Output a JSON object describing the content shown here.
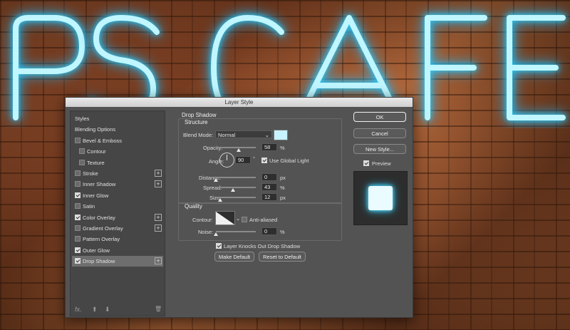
{
  "background": {
    "neon_text": "PS CAFE",
    "neon_color": "#2ad4ff"
  },
  "dialog": {
    "title": "Layer Style",
    "styles_list": [
      {
        "label": "Styles",
        "checkbox": false,
        "checked": false,
        "plus": false,
        "selected": false,
        "indent": 0
      },
      {
        "label": "Blending Options",
        "checkbox": false,
        "checked": false,
        "plus": false,
        "selected": false,
        "indent": 0
      },
      {
        "label": "Bevel & Emboss",
        "checkbox": true,
        "checked": false,
        "plus": false,
        "selected": false,
        "indent": 0
      },
      {
        "label": "Contour",
        "checkbox": true,
        "checked": false,
        "plus": false,
        "selected": false,
        "indent": 1
      },
      {
        "label": "Texture",
        "checkbox": true,
        "checked": false,
        "plus": false,
        "selected": false,
        "indent": 1
      },
      {
        "label": "Stroke",
        "checkbox": true,
        "checked": false,
        "plus": true,
        "selected": false,
        "indent": 0
      },
      {
        "label": "Inner Shadow",
        "checkbox": true,
        "checked": false,
        "plus": true,
        "selected": false,
        "indent": 0
      },
      {
        "label": "Inner Glow",
        "checkbox": true,
        "checked": true,
        "plus": false,
        "selected": false,
        "indent": 0
      },
      {
        "label": "Satin",
        "checkbox": true,
        "checked": false,
        "plus": false,
        "selected": false,
        "indent": 0
      },
      {
        "label": "Color Overlay",
        "checkbox": true,
        "checked": true,
        "plus": true,
        "selected": false,
        "indent": 0
      },
      {
        "label": "Gradient Overlay",
        "checkbox": true,
        "checked": false,
        "plus": true,
        "selected": false,
        "indent": 0
      },
      {
        "label": "Pattern Overlay",
        "checkbox": true,
        "checked": false,
        "plus": false,
        "selected": false,
        "indent": 0
      },
      {
        "label": "Outer Glow",
        "checkbox": true,
        "checked": true,
        "plus": false,
        "selected": false,
        "indent": 0
      },
      {
        "label": "Drop Shadow",
        "checkbox": true,
        "checked": true,
        "plus": true,
        "selected": true,
        "indent": 0
      }
    ],
    "footer": {
      "fx": "fx.",
      "up": "⬆",
      "down": "⬇",
      "trash": "🗑"
    },
    "drop_shadow": {
      "title": "Drop Shadow",
      "structure": {
        "label": "Structure",
        "blend_mode_label": "Blend Mode:",
        "blend_mode_value": "Normal",
        "color": "#c8f2ff",
        "opacity_label": "Opacity:",
        "opacity_value": "58",
        "opacity_unit": "%",
        "opacity_fraction": 0.58,
        "angle_label": "Angle:",
        "angle_value": "90",
        "angle_unit": "°",
        "global_light_label": "Use Global Light",
        "global_light_checked": true,
        "distance_label": "Distance:",
        "distance_value": "0",
        "distance_unit": "px",
        "spread_label": "Spread:",
        "spread_value": "43",
        "spread_unit": "%",
        "size_label": "Size:",
        "size_value": "12",
        "size_unit": "px"
      },
      "quality": {
        "label": "Quality",
        "contour_label": "Contour:",
        "anti_aliased_label": "Anti-aliased",
        "anti_aliased_checked": false,
        "noise_label": "Noise:",
        "noise_value": "0",
        "noise_unit": "%"
      },
      "knocks_out_label": "Layer Knocks Out Drop Shadow",
      "knocks_out_checked": true,
      "make_default_label": "Make Default",
      "reset_default_label": "Reset to Default"
    },
    "buttons": {
      "ok": "OK",
      "cancel": "Cancel",
      "new_style": "New Style...",
      "preview_label": "Preview",
      "preview_checked": true
    }
  }
}
